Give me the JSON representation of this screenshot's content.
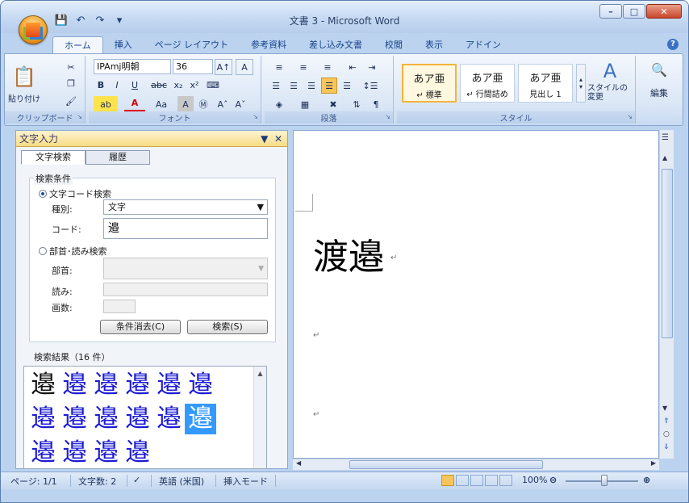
{
  "window": {
    "title": "文書 3 - Microsoft Word"
  },
  "quick_access": {
    "save_icon": "save-icon",
    "undo_icon": "undo-icon",
    "redo_icon": "redo-icon"
  },
  "ribbon_tabs": [
    {
      "label": "ホーム",
      "active": true
    },
    {
      "label": "挿入"
    },
    {
      "label": "ページ レイアウト"
    },
    {
      "label": "参考資料"
    },
    {
      "label": "差し込み文書"
    },
    {
      "label": "校閲"
    },
    {
      "label": "表示"
    },
    {
      "label": "アドイン"
    }
  ],
  "ribbon": {
    "clipboard": {
      "paste_label": "貼り付け",
      "group_label": "クリップボード"
    },
    "font": {
      "font_name": "IPAmj明朝",
      "font_size": "36",
      "group_label": "フォント"
    },
    "paragraph": {
      "group_label": "段落"
    },
    "styles": {
      "items": [
        {
          "sample": "あア亜",
          "name": "↵ 標準",
          "selected": true
        },
        {
          "sample": "あア亜",
          "name": "↵ 行間詰め"
        },
        {
          "sample": "あア亜",
          "name": "見出し 1"
        }
      ],
      "change_styles_label": "スタイルの変更",
      "group_label": "スタイル"
    },
    "editing": {
      "label": "編集"
    }
  },
  "task_pane": {
    "title": "文字入力",
    "tabs": [
      "文字検索",
      "履歴"
    ],
    "search_conditions_label": "検索条件",
    "code_search_label": "文字コード検索",
    "kind_label": "種別:",
    "kind_value": "文字",
    "code_label": "コード:",
    "code_value": "邉",
    "radical_search_label": "部首･読み検索",
    "radical_label": "部首:",
    "reading_label": "読み:",
    "strokes_label": "画数:",
    "clear_button": "条件消去(C)",
    "search_button": "検索(S)",
    "results_label": "検索結果（16 件）",
    "results": [
      [
        "邉",
        "邉",
        "邉",
        "邉",
        "邉",
        "邉"
      ],
      [
        "邉",
        "邉",
        "邉",
        "邉",
        "邉",
        "邉"
      ],
      [
        "邉",
        "邉",
        "邉",
        "邉"
      ]
    ]
  },
  "document": {
    "text": "渡邉",
    "para_mark": "↵"
  },
  "status_bar": {
    "page": "ページ: 1/1",
    "word_count": "文字数: 2",
    "language": "英語 (米国)",
    "mode": "挿入モード",
    "zoom": "100%",
    "zoom_level": 1.0
  },
  "colors": {
    "accent": "#15428b",
    "highlight": "#3399ff",
    "result_text": "#1b1bd4"
  }
}
